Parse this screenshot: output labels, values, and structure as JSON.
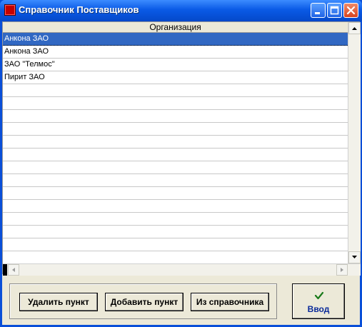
{
  "window": {
    "title": "Справочник Поставщиков"
  },
  "grid": {
    "column_header": "Организация",
    "rows": [
      "Анкона ЗАО",
      "Анкона ЗАО",
      "ЗАО \"Телмос\"",
      "Пирит ЗАО",
      "",
      "",
      "",
      "",
      "",
      "",
      "",
      "",
      "",
      "",
      "",
      "",
      "",
      ""
    ],
    "selected_row": 0
  },
  "buttons": {
    "delete": "Удалить пункт",
    "add": "Добавить пункт",
    "from_directory": "Из справочника",
    "enter": "Ввод"
  },
  "colors": {
    "titlebar": "#0a5ae6",
    "selection": "#3168c3",
    "close_button": "#d64420",
    "enter_label": "#0a2a9a",
    "check": "#1a7a1a"
  },
  "icons": {
    "app": "app-icon",
    "minimize": "minimize-icon",
    "maximize": "maximize-icon",
    "close": "close-icon",
    "check": "check-icon"
  }
}
